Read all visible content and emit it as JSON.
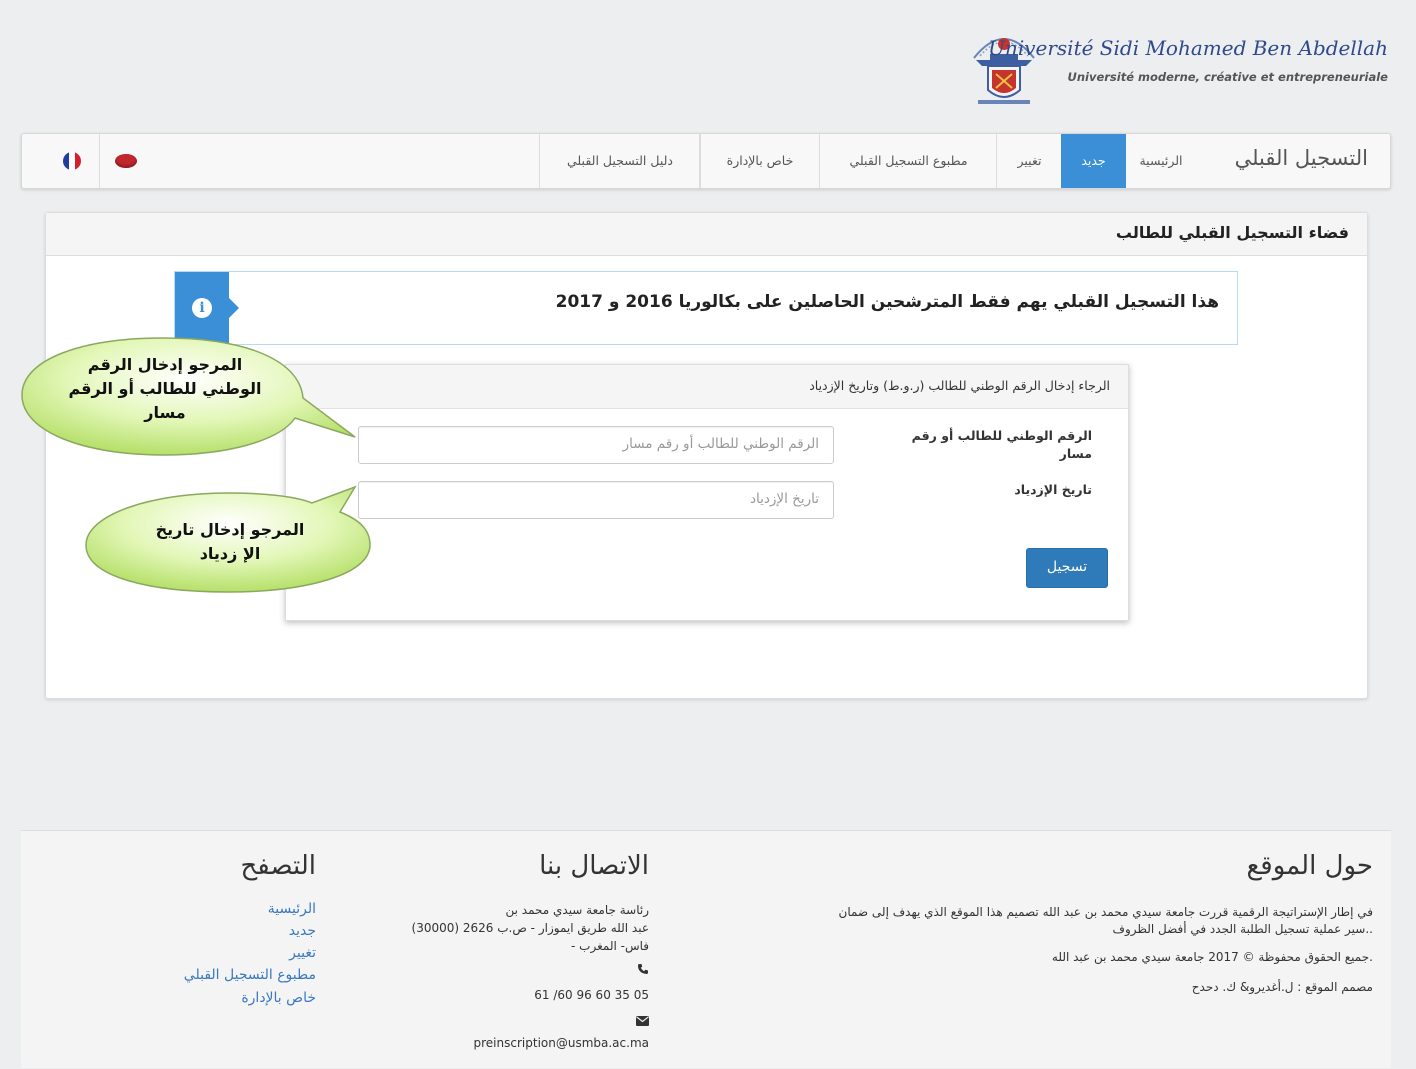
{
  "header": {
    "university_name": "Université Sidi Mohamed Ben Abdellah",
    "tagline": "Université moderne, créative et entrepreneuriale"
  },
  "navbar": {
    "brand": "التسجيل القبلي",
    "items": [
      {
        "label": "الرئيسية"
      },
      {
        "label": "جديد"
      },
      {
        "label": "تغيير"
      },
      {
        "label": "مطبوع التسجيل القبلي"
      },
      {
        "label": "خاص بالإدارة"
      },
      {
        "label": "دليل التسجيل القبلي"
      }
    ],
    "active_item": "جديد",
    "languages": [
      {
        "icon": "morocco-flag-icon"
      },
      {
        "icon": "france-flag-icon"
      }
    ]
  },
  "main": {
    "panel_title": "فضاء التسجيل القبلي للطالب",
    "info_message": "هذا التسجيل القبلي يهم فقط المترشحين الحاصلين على بكالوريا 2016 و 2017",
    "form": {
      "heading": "الرجاء إدخال الرقم الوطني للطالب (ر.و.ط) وتاريخ الإزدياد",
      "id_label": "الرقم الوطني للطالب أو رقم مسار",
      "id_placeholder": "الرقم الوطني للطالب أو رقم مسار",
      "birthdate_label": "تاريخ الإزدياد",
      "birthdate_placeholder": "تاريخ الإزدياد",
      "submit_label": "تسجيل"
    }
  },
  "callouts": {
    "id_hint": "المرجو إدخال الرقم الوطني للطالب أو الرقم مسار",
    "date_hint": "المرجو إدخال تاريخ الإ زدياد"
  },
  "footer": {
    "about": {
      "title": "حول الموقع",
      "text_line1": "في إطار الإستراتيجة الرقمية قررت جامعة سيدي محمد بن عبد الله تصميم هذا الموقع الذي يهدف إلى ضمان",
      "text_line2": "سير عملية تسجيل الطلبة الجدد في أفضل الظروف..",
      "copyright": "جميع الحقوق محفوظة © 2017 جامعة سيدي محمد بن عبد الله.",
      "designer": "مصمم الموقع : ل.أغديرو& ك. دحدح"
    },
    "contact": {
      "title": "الاتصال بنا",
      "address_line1": "رئاسة جامعة سيدي محمد بن",
      "address_line2": "عبد الله طريق ايموزار - ص.ب 2626 (30000)",
      "address_line3": "- فاس- المغرب",
      "phone": "61 /60 96 60 35 05",
      "email": "preinscription@usmba.ac.ma"
    },
    "browse": {
      "title": "التصفح",
      "links": [
        "الرئيسية",
        "جديد",
        "تغيير",
        "مطبوع التسجيل القبلي",
        "خاص بالإدارة"
      ]
    }
  },
  "colors": {
    "accent": "#3a8fd6",
    "button": "#2f7ab9",
    "callout_green": "#c9ee8a"
  }
}
